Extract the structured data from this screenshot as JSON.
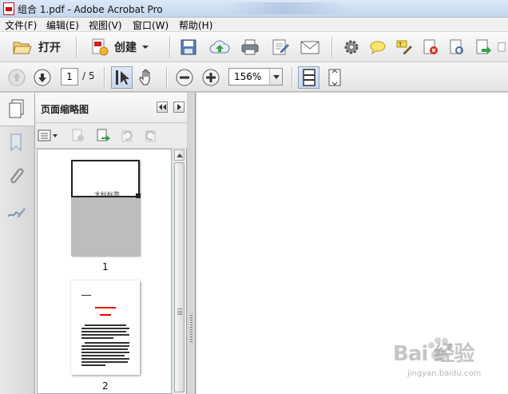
{
  "window": {
    "title": "组合 1.pdf - Adobe Acrobat Pro"
  },
  "menu": [
    "文件(F)",
    "编辑(E)",
    "视图(V)",
    "窗口(W)",
    "帮助(H)"
  ],
  "toolbar": {
    "open_label": "打开",
    "create_label": "创建"
  },
  "navigation": {
    "current_page": "1",
    "total_pages": "/ 5",
    "zoom": "156%"
  },
  "thumbnail_panel": {
    "title": "页面缩略图",
    "pages": [
      {
        "number": "1",
        "caption": "大标标签"
      },
      {
        "number": "2"
      }
    ]
  },
  "watermark": {
    "brand": "Bai 经验",
    "url": "jingyan.baidu.com"
  },
  "colors": {
    "accent_red": "#cc0000",
    "toolbar_bg": "#e6e6e6",
    "panel_bg": "#f2f2f2"
  }
}
